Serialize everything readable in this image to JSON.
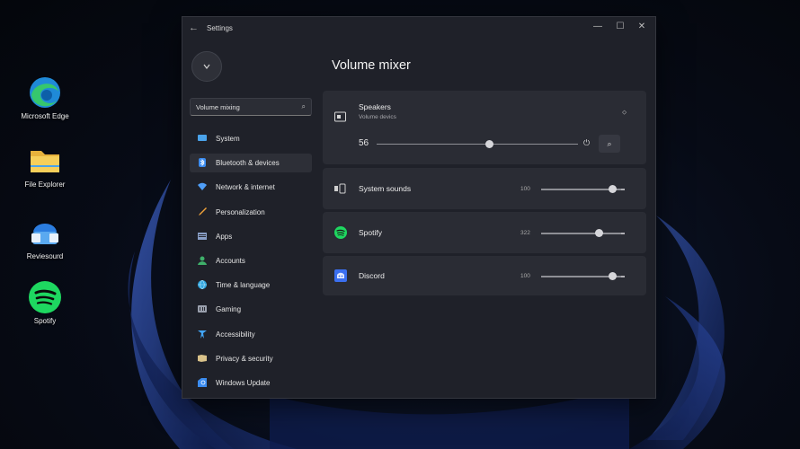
{
  "desktop": {
    "icons": [
      {
        "name": "edge-icon",
        "label": "Microsoft Edge"
      },
      {
        "name": "folder-icon",
        "label": "File Explorer"
      },
      {
        "name": "app-icon",
        "label": "Reviesourd"
      },
      {
        "name": "spotify-icon",
        "label": "Spotify"
      }
    ]
  },
  "window": {
    "title": "Settings",
    "back_glyph": "←",
    "minimize": "—",
    "maximize": "☐",
    "close": "✕"
  },
  "sidebar": {
    "search_value": "Volume mixing",
    "items": [
      {
        "label": "System",
        "icon": "system-icon",
        "color": "#4aa3ea"
      },
      {
        "label": "Bluetooth & devices",
        "icon": "bluetooth-icon",
        "color": "#3b8cf0"
      },
      {
        "label": "Network & internet",
        "icon": "network-icon",
        "color": "#4f9ef8"
      },
      {
        "label": "Personalization",
        "icon": "brush-icon",
        "color": "#f0a23a"
      },
      {
        "label": "Apps",
        "icon": "apps-icon",
        "color": "#8aa0c8"
      },
      {
        "label": "Accounts",
        "icon": "accounts-icon",
        "color": "#3fb06a"
      },
      {
        "label": "Time & language",
        "icon": "globe-icon",
        "color": "#2fa6e0"
      },
      {
        "label": "Gaming",
        "icon": "gaming-icon",
        "color": "#9aa0ad"
      },
      {
        "label": "Accessibility",
        "icon": "accessibility-icon",
        "color": "#42a5f5"
      },
      {
        "label": "Privacy & security",
        "icon": "shield-icon",
        "color": "#d9c28a"
      },
      {
        "label": "Windows Update",
        "icon": "update-icon",
        "color": "#3b8cf0"
      }
    ]
  },
  "main": {
    "title": "Volume mixer",
    "speakers": {
      "title": "Speakers",
      "subtitle": "Volume devics",
      "value": "56",
      "level": 0.56
    },
    "apps": [
      {
        "name": "System sounds",
        "value": "100",
        "level": 0.88,
        "icon": "system-sounds-icon"
      },
      {
        "name": "Spotify",
        "value": "322",
        "level": 0.72,
        "icon": "spotify-icon"
      },
      {
        "name": "Discord",
        "value": "100",
        "level": 0.88,
        "icon": "discord-icon"
      }
    ]
  },
  "colors": {
    "spotify": "#1ed760",
    "discord_bg": "#3b6ff0",
    "accent": "#3b8cf0"
  }
}
